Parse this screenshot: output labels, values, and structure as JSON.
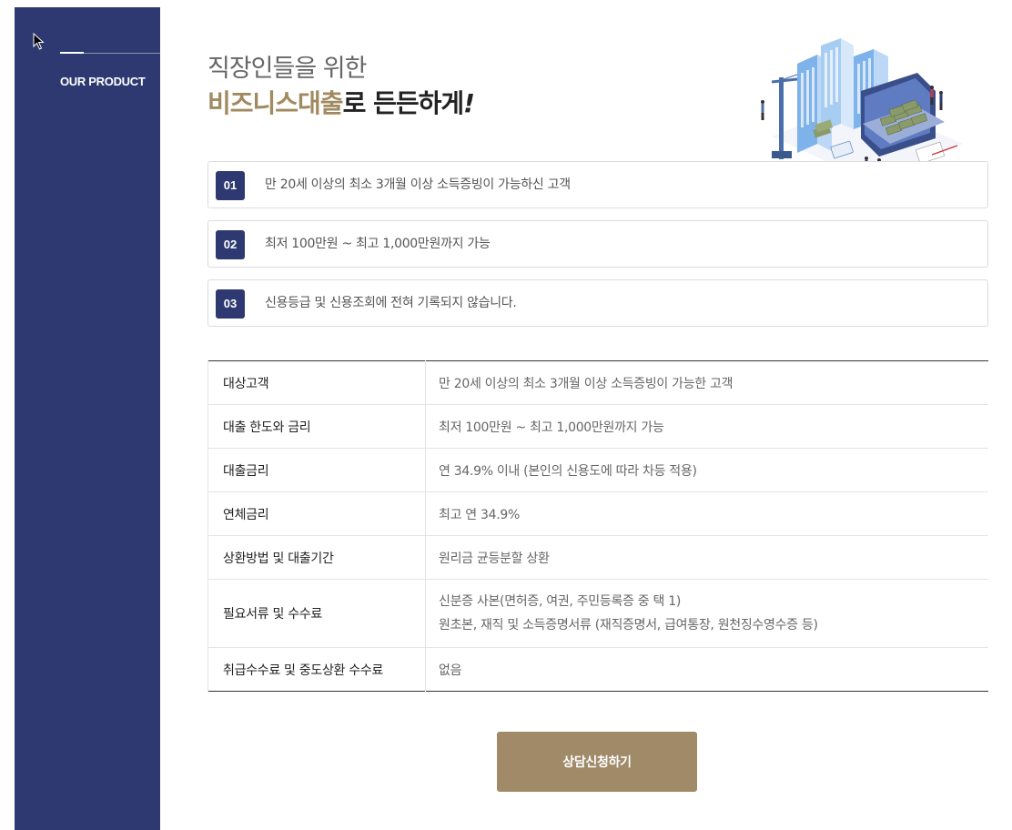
{
  "sidebar": {
    "label": "OUR PRODUCT"
  },
  "headline": {
    "line1": "직장인들을 위한",
    "line2_accent": "비즈니스대출",
    "line2_rest": "로 든든하게",
    "line2_bang": "!"
  },
  "features": [
    {
      "num": "01",
      "text": "만 20세 이상의 최소 3개월 이상 소득증빙이 가능하신 고객"
    },
    {
      "num": "02",
      "text": "최저 100만원 ~ 최고 1,000만원까지 가능"
    },
    {
      "num": "03",
      "text": "신용등급 및 신용조회에 전혀 기록되지 않습니다."
    }
  ],
  "table": {
    "rows": [
      {
        "key": "대상고객",
        "value": "만 20세 이상의 최소 3개월 이상 소득증빙이 가능한 고객"
      },
      {
        "key": "대출 한도와 금리",
        "value": "최저 100만원 ~ 최고 1,000만원까지 가능"
      },
      {
        "key": "대출금리",
        "value": "연 34.9% 이내 (본인의 신용도에 따라 차등 적용)"
      },
      {
        "key": "연체금리",
        "value": "최고 연 34.9%"
      },
      {
        "key": "상환방법 및 대출기간",
        "value": "원리금 균등분할 상환"
      },
      {
        "key": "필요서류 및 수수료",
        "value": "신분증 사본(면허증, 여권, 주민등록증 중 택 1)",
        "value2": "원초본, 재직 및 소득증명서류 (재직증명서, 급여통장, 원천징수영수증 등)"
      },
      {
        "key": "취급수수료 및 중도상환 수수료",
        "value": "없음"
      }
    ]
  },
  "cta": {
    "label": "상담신청하기"
  },
  "colors": {
    "navy": "#2d3970",
    "gold": "#a08a60",
    "button": "#a08a68"
  }
}
